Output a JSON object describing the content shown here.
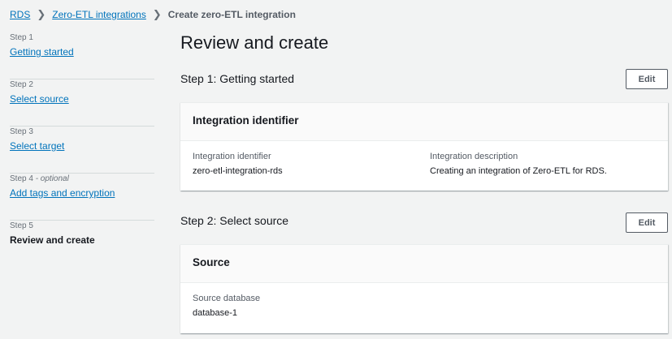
{
  "breadcrumb": {
    "items": [
      "RDS",
      "Zero-ETL integrations"
    ],
    "current": "Create zero-ETL integration"
  },
  "sidebar": {
    "steps": [
      {
        "label": "Step 1",
        "optional": "",
        "title": "Getting started"
      },
      {
        "label": "Step 2",
        "optional": "",
        "title": "Select source"
      },
      {
        "label": "Step 3",
        "optional": "",
        "title": "Select target"
      },
      {
        "label": "Step 4",
        "optional": " - optional",
        "title": "Add tags and encryption"
      },
      {
        "label": "Step 5",
        "optional": "",
        "title": "Review and create"
      }
    ]
  },
  "main": {
    "title": "Review and create",
    "sections": [
      {
        "heading": "Step 1: Getting started",
        "edit_label": "Edit",
        "card_title": "Integration identifier",
        "fields": [
          {
            "label": "Integration identifier",
            "value": "zero-etl-integration-rds"
          },
          {
            "label": "Integration description",
            "value": "Creating an integration of Zero-ETL for RDS."
          }
        ]
      },
      {
        "heading": "Step 2: Select source",
        "edit_label": "Edit",
        "card_title": "Source",
        "fields": [
          {
            "label": "Source database",
            "value": "database-1"
          }
        ]
      }
    ]
  }
}
